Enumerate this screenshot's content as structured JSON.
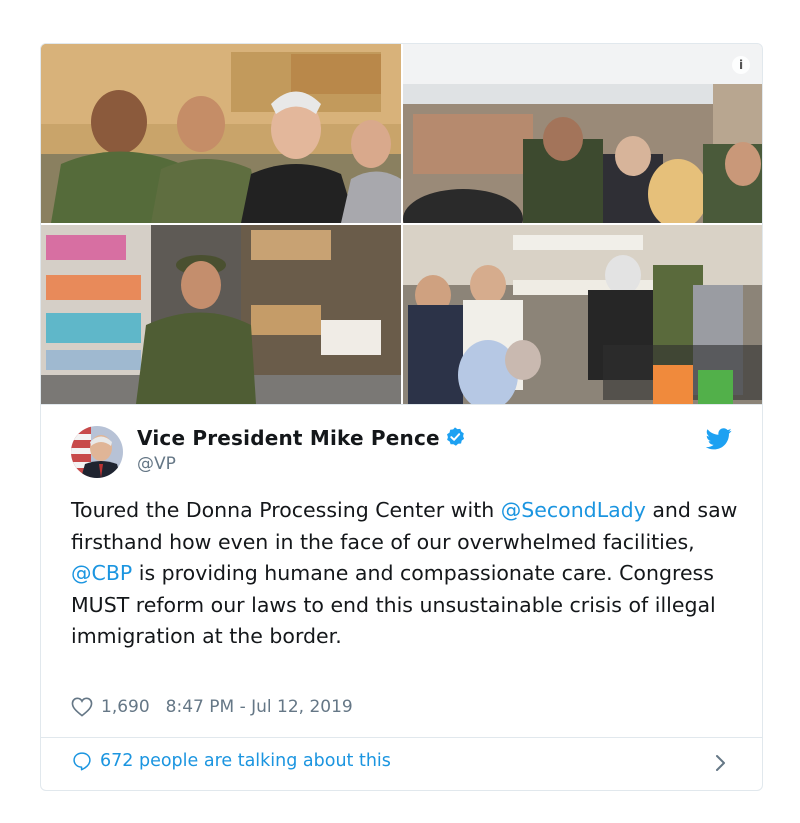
{
  "tweet": {
    "author_name": "Vice President Mike Pence",
    "handle": "@VP",
    "text_parts": {
      "p1": "Toured the Donna Processing Center with ",
      "m1": "@SecondLady",
      "p2": " and saw firsthand how even in the face of our overwhelmed facilities, ",
      "m2": "@CBP",
      "p3": " is providing humane and compassionate care. Congress MUST reform our laws to end this unsustainable crisis of illegal immigration at the border."
    },
    "likes": "1,690",
    "timestamp": "8:47 PM - Jul 12, 2019",
    "talking": "672 people are talking about this"
  },
  "media": {
    "photos": [
      {
        "name": "pence-with-border-patrol-agents"
      },
      {
        "name": "processing-center-crowd"
      },
      {
        "name": "agent-by-supply-shelves"
      },
      {
        "name": "pence-with-children"
      }
    ],
    "info_label": "i"
  },
  "colors": {
    "link": "#1b95e0",
    "muted": "#657786",
    "border": "#e1e8ed",
    "text": "#14171a"
  },
  "icons": [
    "info-icon",
    "verified-badge-icon",
    "twitter-bird-icon",
    "heart-icon",
    "comment-bubble-icon",
    "chevron-right-icon"
  ]
}
